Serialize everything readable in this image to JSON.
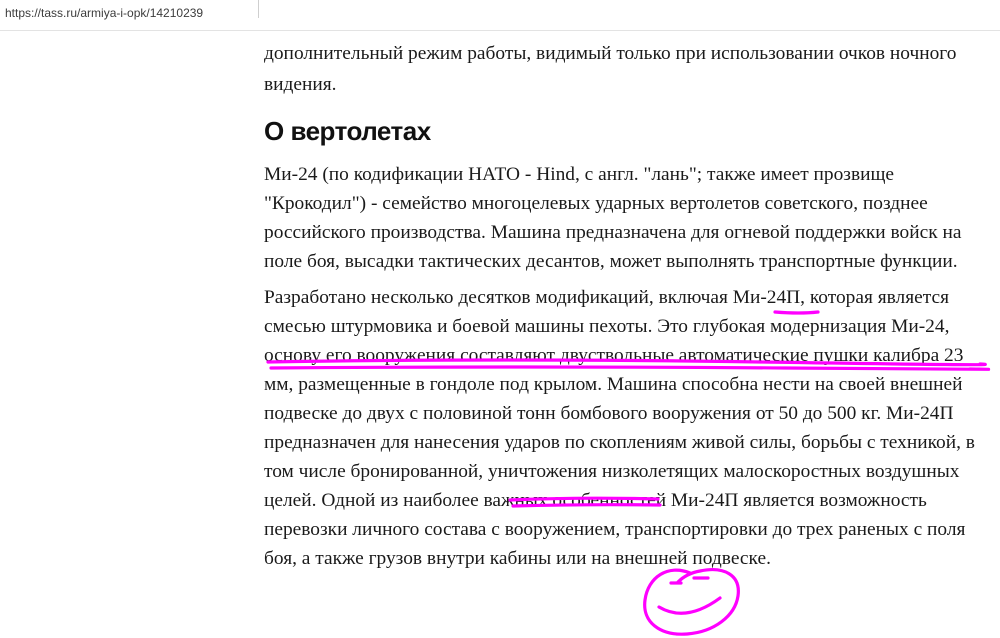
{
  "browser": {
    "url": "https://tass.ru/armiya-i-opk/14210239"
  },
  "article": {
    "intro_text": "дополнительный режим работы, видимый только при использовании очков ночного видения.",
    "heading": "О вертолетах",
    "paragraph1": "Ми-24 (по кодификации НАТО - Hind, с англ. \"лань\"; также имеет прозвище \"Крокодил\") - семейство многоцелевых ударных вертолетов советского, позднее российского производства. Машина предназначена для огневой поддержки войск на поле боя, высадки тактических десантов, может выполнять транспортные функции.",
    "paragraph2": "Разработано несколько десятков модификаций, включая Ми-24П, которая является смесью штурмовика и боевой машины пехоты. Это глубокая модернизация Ми-24, основу его вооружения составляют двуствольные автоматические пушки калибра 23 мм, размещенные в гондоле под крылом. Машина способна нести на своей внешней подвеске до двух с половиной тонн бомбового вооружения от 50 до 500 кг. Ми-24П предназначен для нанесения ударов по скоплениям живой силы, борьбы с техникой, в том числе бронированной, уничтожения низколетящих малоскоростных воздушных целей. Одной из наиболее важных особенностей Ми-24П является возможность перевозки личного состава с вооружением, транспортировки до трех раненых с поля боя, а также грузов внутри кабины или на внешней подвеске."
  },
  "annotations": {
    "ink_color": "#ff00ff",
    "icon": "smiley-face-drawing"
  }
}
